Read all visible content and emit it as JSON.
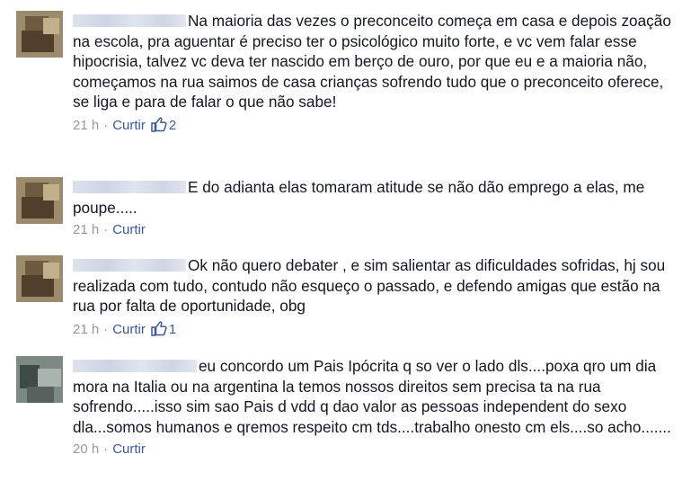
{
  "comments": [
    {
      "text": "Na maioria das vezes o preconceito começa em casa e depois zoação na escola, pra aguentar é preciso ter o psicológico muito forte, e vc  vem falar esse hipocrisia, talvez vc deva ter nascido em berço de ouro, por que eu e a maioria não, começamos na rua saimos de casa crianças sofrendo tudo que o preconceito oferece, se liga e para de falar o que não sabe!",
      "time": "21 h",
      "action": "Curtir",
      "likes": "2"
    },
    {
      "text": "E do adianta elas tomaram atitude se não dão emprego a elas, me poupe.....",
      "time": "21 h",
      "action": "Curtir",
      "likes": ""
    },
    {
      "text": "Ok não quero debater , e sim salientar as dificuldades sofridas, hj sou realizada com tudo, contudo não esqueço o passado, e defendo amigas que estão na rua por falta de oportunidade, obg",
      "time": "21 h",
      "action": "Curtir",
      "likes": "1"
    },
    {
      "text": "eu concordo um Pais Ipócrita q so ver o lado dls....poxa qro um dia mora na Italia ou na argentina la temos nossos direitos sem precisa ta na rua sofrendo.....isso sim sao Pais d vdd q dao valor as pessoas independent do sexo dla...somos humanos e qremos respeito cm tds....trabalho onesto cm els....so acho.......",
      "time": "20 h",
      "action": "Curtir",
      "likes": ""
    }
  ],
  "separator": "·",
  "colors": {
    "link": "#3b5998",
    "meta": "#9197a3",
    "text": "#141823"
  },
  "icons": {
    "like": "thumbs-up-icon"
  }
}
